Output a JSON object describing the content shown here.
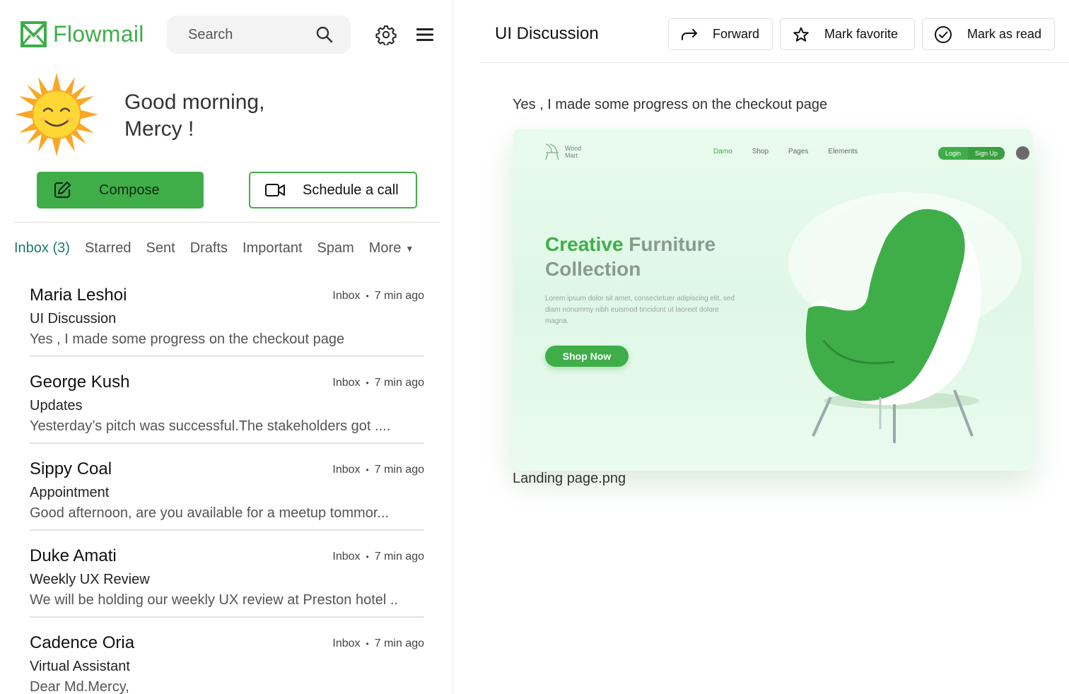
{
  "app": {
    "name": "Flowmail",
    "brand_color": "#3fae49"
  },
  "search": {
    "placeholder": "Search"
  },
  "greeting": {
    "line1": "Good morning,",
    "line2": "Mercy !"
  },
  "actions_left": {
    "compose": "Compose",
    "schedule_call": "Schedule a call"
  },
  "tabs": [
    {
      "label": "Inbox (3)",
      "active": true
    },
    {
      "label": "Starred"
    },
    {
      "label": "Sent"
    },
    {
      "label": "Drafts"
    },
    {
      "label": "Important"
    },
    {
      "label": "Spam"
    },
    {
      "label": "More"
    }
  ],
  "mails": [
    {
      "sender": "Maria Leshoi",
      "folder": "Inbox",
      "time": "7 min ago",
      "subject": "UI Discussion",
      "preview": "Yes , I made some progress on the checkout page"
    },
    {
      "sender": "George Kush",
      "folder": "Inbox",
      "time": "7 min ago",
      "subject": "Updates",
      "preview": "Yesterday’s pitch was successful.The stakeholders got ...."
    },
    {
      "sender": "Sippy Coal",
      "folder": "Inbox",
      "time": "7 min ago",
      "subject": "Appointment",
      "preview": "Good afternoon, are you available for a meetup tommor..."
    },
    {
      "sender": "Duke Amati",
      "folder": "Inbox",
      "time": "7 min ago",
      "subject": "Weekly UX Review",
      "preview": "We will be holding our weekly UX review at Preston hotel .."
    },
    {
      "sender": "Cadence Oria",
      "folder": "Inbox",
      "time": "7 min ago",
      "subject": "Virtual Assistant",
      "preview": "Dear Md.Mercy,"
    }
  ],
  "thread": {
    "title": "UI Discussion",
    "actions": {
      "forward": "Forward",
      "mark_favorite": "Mark favorite",
      "mark_read": "Mark as read"
    },
    "body": "Yes , I made some progress on the checkout page",
    "attachment": {
      "filename": "Landing page.png",
      "mockup": {
        "logo": [
          "Wood",
          "Mart"
        ],
        "nav": [
          "Damo",
          "Shop",
          "Pages",
          "Elements"
        ],
        "login": "Login",
        "signup": "Sign Up",
        "headline_green": "Creative",
        "headline_rest1": "Furniture",
        "headline_rest2": "Collection",
        "paragraph": "Lorem ipsum dolor sit amet, consectetuer adipiscing elit, sed diam nonummy nibh euismod tincidunt ut laoreet dolore magna.",
        "cta": "Shop Now"
      }
    }
  },
  "icons": {
    "brand": "envelope-icon",
    "search": "search-icon",
    "settings": "gear-icon",
    "menu": "hamburger-icon",
    "compose": "edit-icon",
    "call": "video-camera-icon",
    "forward": "forward-arrow-icon",
    "favorite": "star-icon",
    "read": "check-circle-icon"
  }
}
